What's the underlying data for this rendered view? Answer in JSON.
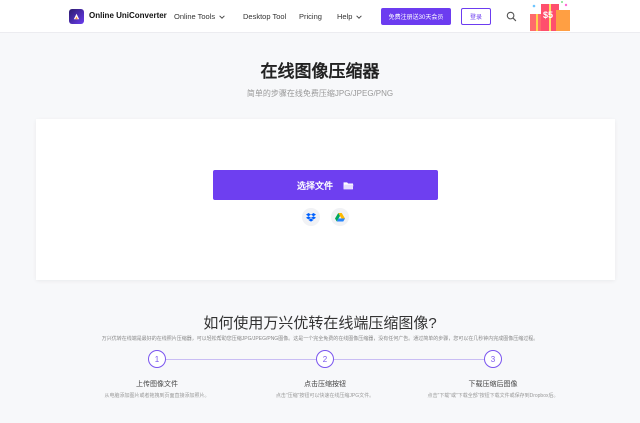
{
  "header": {
    "brand": "Online UniConverter",
    "nav": {
      "online_tools": "Online Tools",
      "desktop_tool": "Desktop Tool",
      "pricing": "Pricing",
      "help": "Help"
    },
    "trial_button": "免费注册送30天会员",
    "login_button": "登录",
    "promo_badge": "$5"
  },
  "hero": {
    "title": "在线图像压缩器",
    "subtitle": "简单的步骤在线免费压缩JPG/JPEG/PNG"
  },
  "upload": {
    "select_button": "选择文件",
    "cloud_sources": [
      "dropbox-icon",
      "google-drive-icon"
    ]
  },
  "howto": {
    "title": "如何使用万兴优转在线端压缩图像?",
    "description": "万兴优转在线端是最好的在线照片压缩器，可以轻松帮助您压缩JPG/JPEG/PNG图像。这是一个完全免费的在线图像压缩器，没有任何广告。通过简单的步骤，您可以在几秒钟内完成图像压缩过程。",
    "steps": [
      {
        "number": "1",
        "title": "上传图像文件",
        "desc": "从电脑添加图片或者拖拽到页面直接添加照片。"
      },
      {
        "number": "2",
        "title": "点击压缩按钮",
        "desc": "点击\"压缩\"按钮可以快速在线压缩JPG文件。"
      },
      {
        "number": "3",
        "title": "下载压缩后图像",
        "desc": "点击\"下载\"或\"下载全部\"按钮下载文件或保存到Dropbox后。"
      }
    ]
  },
  "colors": {
    "accent": "#6e3ff0",
    "background": "#f7f8fa"
  }
}
